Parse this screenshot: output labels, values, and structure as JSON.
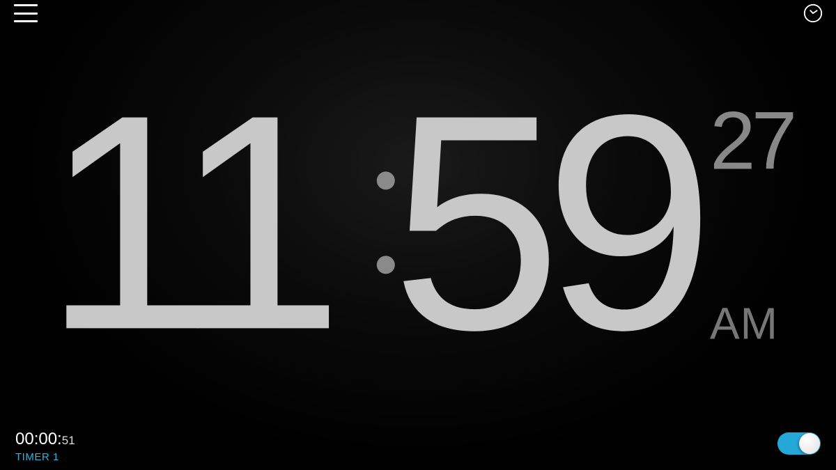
{
  "icons": {
    "menu": "hamburger-menu",
    "clock": "alarm-clock"
  },
  "clock": {
    "hours": "11",
    "minutes": "59",
    "seconds": "27",
    "ampm": "AM"
  },
  "timer": {
    "time_main": "00:00:",
    "time_sub": "51",
    "label": "TIMER 1",
    "enabled": true
  },
  "colors": {
    "accent": "#24a8d8",
    "text_primary": "#c8c8c8",
    "text_secondary": "#888"
  }
}
